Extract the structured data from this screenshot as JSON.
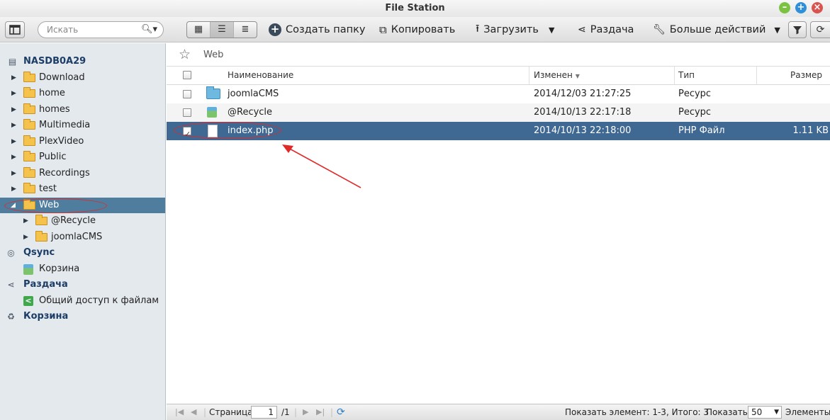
{
  "window": {
    "title": "File Station"
  },
  "toolbar": {
    "search_placeholder": "Искать",
    "create_folder": "Создать папку",
    "copy": "Копировать",
    "upload": "Загрузить",
    "share": "Раздача",
    "more_actions": "Больше действий"
  },
  "sidebar": {
    "root": "NASDB0A29",
    "folders": [
      "Download",
      "home",
      "homes",
      "Multimedia",
      "PlexVideo",
      "Public",
      "Recordings",
      "test"
    ],
    "selected_folder": "Web",
    "subfolders": [
      "@Recycle",
      "joomlaCMS"
    ],
    "qsync": {
      "label": "Qsync",
      "child": "Корзина"
    },
    "share": {
      "label": "Раздача",
      "child": "Общий доступ к файлам"
    },
    "trash": {
      "label": "Корзина"
    }
  },
  "breadcrumb": {
    "path": "Web"
  },
  "table": {
    "columns": {
      "name": "Наименование",
      "modified": "Изменен",
      "type": "Тип",
      "size": "Размер"
    },
    "rows": [
      {
        "name": "joomlaCMS",
        "modified": "2014/12/03 21:27:25",
        "type": "Ресурс",
        "size": "",
        "icon": "folder-icon",
        "checked": false
      },
      {
        "name": "@Recycle",
        "modified": "2014/10/13 22:17:18",
        "type": "Ресурс",
        "size": "",
        "icon": "recycle-bin-icon",
        "checked": false
      },
      {
        "name": "index.php",
        "modified": "2014/10/13 22:18:00",
        "type": "PHP Файл",
        "size": "1.11 KB",
        "icon": "file-icon",
        "checked": true
      }
    ]
  },
  "footer": {
    "page_label": "Страница",
    "page_value": "1",
    "page_total": "/1",
    "showing": "Показать элемент: 1-3, Итого: 3",
    "show_label": "Показать",
    "per_page": "50",
    "items_label": "Элементы"
  },
  "colors": {
    "selection": "#3f6893",
    "sidebar_selection": "#4f7d9d",
    "annotation": "#e02a2a"
  }
}
